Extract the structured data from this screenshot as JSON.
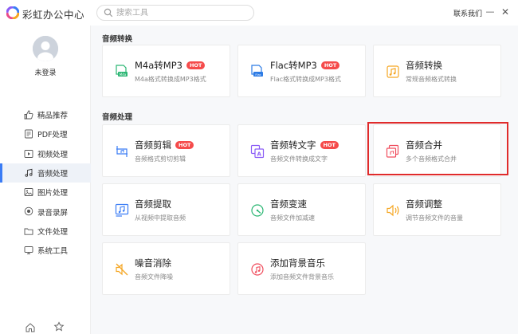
{
  "app": {
    "title": "彩虹办公中心",
    "contact_label": "联系我们",
    "minimize_glyph": "—",
    "close_glyph": "✕"
  },
  "search": {
    "placeholder": "搜索工具"
  },
  "user": {
    "login_label": "未登录"
  },
  "sidebar": {
    "items": [
      {
        "label": "精品推荐",
        "icon": "thumbs-up-icon"
      },
      {
        "label": "PDF处理",
        "icon": "pdf-icon"
      },
      {
        "label": "视频处理",
        "icon": "video-icon"
      },
      {
        "label": "音频处理",
        "icon": "music-note-icon",
        "active": true
      },
      {
        "label": "图片处理",
        "icon": "image-icon"
      },
      {
        "label": "录音录屏",
        "icon": "record-icon"
      },
      {
        "label": "文件处理",
        "icon": "folder-icon"
      },
      {
        "label": "系统工具",
        "icon": "system-tools-icon"
      }
    ]
  },
  "sections": [
    {
      "title": "音频转换",
      "cards": [
        {
          "title": "M4a转MP3",
          "desc": "M4a格式转换成MP3格式",
          "hot": "HOT",
          "icon": "m4a-convert-icon",
          "color": "#2bb673"
        },
        {
          "title": "Flac转MP3",
          "desc": "Flac格式转换成MP3格式",
          "hot": "HOT",
          "icon": "flac-convert-icon",
          "color": "#2c7be5"
        },
        {
          "title": "音频转换",
          "desc": "常规音频格式转换",
          "icon": "audio-convert-icon",
          "color": "#f5a623"
        }
      ]
    },
    {
      "title": "音频处理",
      "cards": [
        {
          "title": "音频剪辑",
          "desc": "音频格式剪切剪辑",
          "hot": "HOT",
          "icon": "audio-cut-icon",
          "color": "#3a7cf5"
        },
        {
          "title": "音频转文字",
          "desc": "音频文件转换成文字",
          "hot": "HOT",
          "icon": "audio-to-text-icon",
          "color": "#8b5cf6"
        },
        {
          "title": "音频合并",
          "desc": "多个音频格式合并",
          "icon": "audio-merge-icon",
          "color": "#f04e5e"
        },
        {
          "title": "音频提取",
          "desc": "从视频中提取音频",
          "icon": "audio-extract-icon",
          "color": "#3a7cf5"
        },
        {
          "title": "音频变速",
          "desc": "音频文件加减速",
          "icon": "audio-speed-icon",
          "color": "#2bb673"
        },
        {
          "title": "音频调整",
          "desc": "调节音频文件的音量",
          "icon": "volume-adjust-icon",
          "color": "#f5a623"
        },
        {
          "title": "噪音消除",
          "desc": "音频文件降噪",
          "icon": "noise-reduce-icon",
          "color": "#f5a623"
        },
        {
          "title": "添加背景音乐",
          "desc": "添加音频文件背景音乐",
          "icon": "bg-music-icon",
          "color": "#f04e5e"
        }
      ]
    }
  ],
  "colors": {
    "accent": "#3a7cf5",
    "hot_badge": "#f54b4b",
    "highlight": "#e02b2b"
  }
}
